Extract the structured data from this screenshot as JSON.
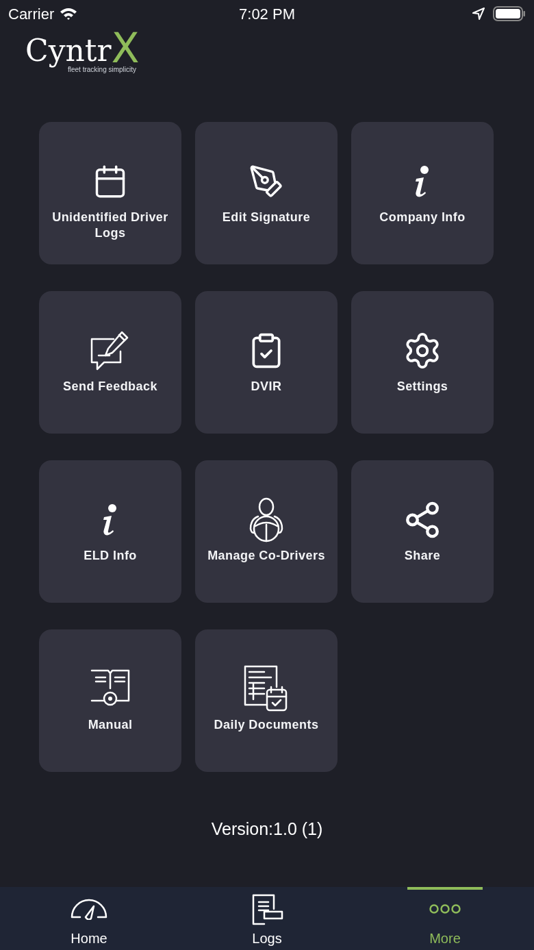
{
  "status_bar": {
    "carrier": "Carrier",
    "time": "7:02 PM"
  },
  "logo": {
    "name": "Cyntr",
    "accent": "X",
    "tagline": "fleet tracking simplicity"
  },
  "tiles": [
    {
      "label": "Unidentified Driver Logs"
    },
    {
      "label": "Edit Signature"
    },
    {
      "label": "Company Info"
    },
    {
      "label": "Send Feedback"
    },
    {
      "label": "DVIR"
    },
    {
      "label": "Settings"
    },
    {
      "label": "ELD Info"
    },
    {
      "label": "Manage Co-Drivers"
    },
    {
      "label": "Share"
    },
    {
      "label": "Manual"
    },
    {
      "label": "Daily Documents"
    }
  ],
  "version": "Version:1.0 (1)",
  "tab_bar": [
    {
      "label": "Home",
      "selected": false
    },
    {
      "label": "Logs",
      "selected": false
    },
    {
      "label": "More",
      "selected": true
    }
  ]
}
